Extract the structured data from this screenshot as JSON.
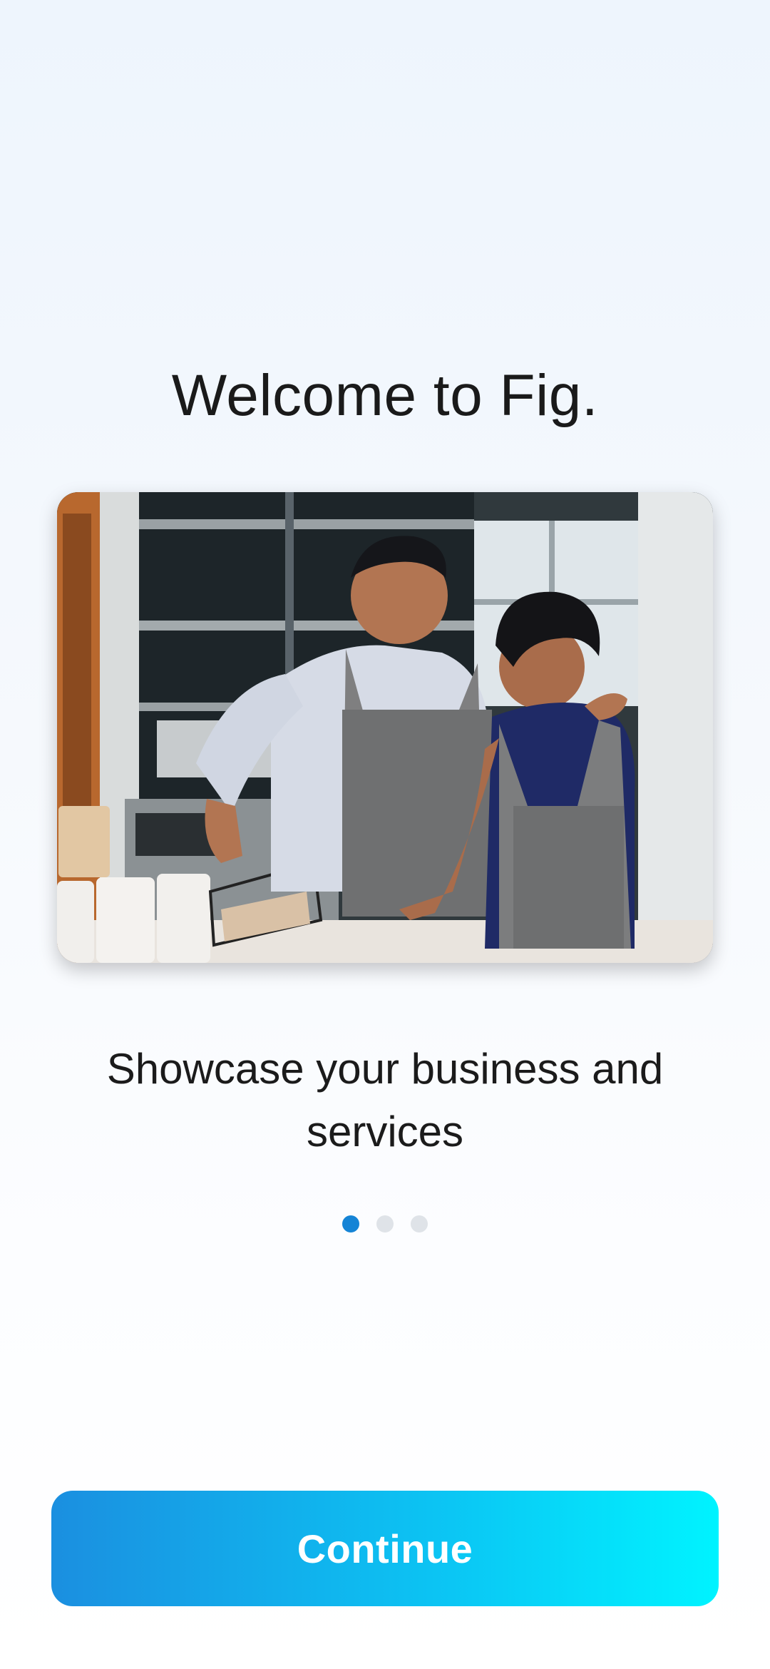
{
  "onboarding": {
    "title": "Welcome to Fig.",
    "subtitle": "Showcase your business and services",
    "pagination": {
      "total": 3,
      "active_index": 0
    },
    "continue_label": "Continue"
  },
  "colors": {
    "accent": "#1584d6",
    "dot_inactive": "#dfe3e8",
    "button_gradient_start": "#1b8fe0",
    "button_gradient_end": "#00f3ff"
  }
}
